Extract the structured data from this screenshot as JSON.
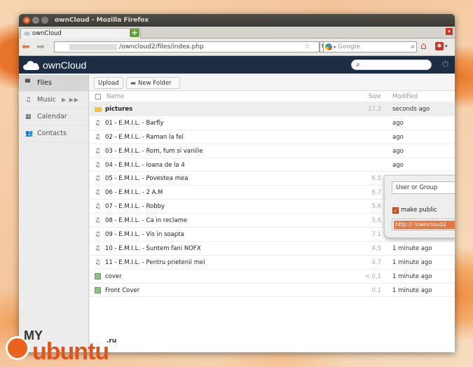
{
  "window": {
    "title": "ownCloud - Mozilla Firefox"
  },
  "browser": {
    "tab_title": "ownCloud",
    "url": "/owncloud2/files/index.php",
    "search_placeholder": "Google"
  },
  "app": {
    "logo_text": "ownCloud",
    "search_value": ""
  },
  "sidebar": {
    "items": [
      {
        "label": "Files",
        "icon": "folder-icon",
        "active": true
      },
      {
        "label": "Music",
        "icon": "music-icon",
        "extra": "▶ ▶▶"
      },
      {
        "label": "Calendar",
        "icon": "calendar-icon"
      },
      {
        "label": "Contacts",
        "icon": "contacts-icon"
      }
    ]
  },
  "toolbar": {
    "upload_label": "Upload",
    "new_folder_label": "New Folder"
  },
  "table": {
    "headers": {
      "name": "Name",
      "size": "Size",
      "modified": "Modified"
    },
    "rows": [
      {
        "name": "pictures",
        "size": "17.3",
        "modified": "seconds ago",
        "type": "folder"
      },
      {
        "name": "01 - E.M.I.L. - Barfly",
        "size": "",
        "modified": "ago",
        "type": "music"
      },
      {
        "name": "02 - E.M.I.L. - Raman la fel",
        "size": "",
        "modified": "ago",
        "type": "music"
      },
      {
        "name": "03 - E.M.I.L. - Rom, fum si vanilie",
        "size": "",
        "modified": "ago",
        "type": "music"
      },
      {
        "name": "04 - E.M.I.L. - Ioana de la 4",
        "size": "",
        "modified": "ago",
        "type": "music"
      },
      {
        "name": "05 - E.M.I.L. - Povestea mea",
        "size": "6.5",
        "modified": "1 minute ago",
        "type": "music"
      },
      {
        "name": "06 - E.M.I.L. - 2 A.M",
        "size": "6.7",
        "modified": "1 minute ago",
        "type": "music"
      },
      {
        "name": "07 - E.M.I.L. - Robby",
        "size": "5.6",
        "modified": "1 minute ago",
        "type": "music"
      },
      {
        "name": "08 - E.M.I.L. - Ca in reclame",
        "size": "5.6",
        "modified": "1 minute ago",
        "type": "music"
      },
      {
        "name": "09 - E.M.I.L. - Vis in soapta",
        "size": "7.1",
        "modified": "1 minute ago",
        "type": "music"
      },
      {
        "name": "10 - E.M.I.L. - Suntem fani NOFX",
        "size": "4.5",
        "modified": "1 minute ago",
        "type": "music"
      },
      {
        "name": "11 - E.M.I.L. - Pentru prietenii mei",
        "size": "4.7",
        "modified": "1 minute ago",
        "type": "music"
      },
      {
        "name": "cover",
        "size": "< 0.1",
        "modified": "1 minute ago",
        "type": "image"
      },
      {
        "name": "Front Cover",
        "size": "0.1",
        "modified": "1 minute ago",
        "type": "image"
      }
    ]
  },
  "share_dialog": {
    "select_value": "User or Group",
    "make_public_label": "make public",
    "link_value": "http://                          /owncloud2"
  },
  "watermark": {
    "my": "MY",
    "ubuntu": "ubuntu",
    "ru": ".ru"
  }
}
